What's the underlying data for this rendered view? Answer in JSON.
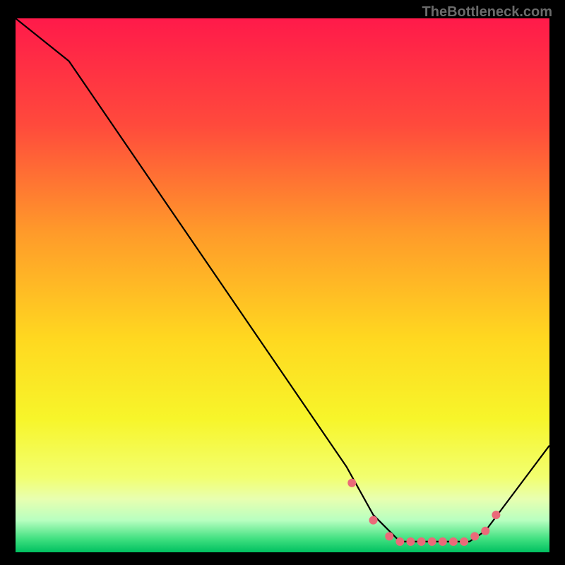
{
  "watermark": "TheBottleneck.com",
  "chart_data": {
    "type": "line",
    "title": "",
    "xlabel": "",
    "ylabel": "",
    "xlim": [
      0,
      100
    ],
    "ylim": [
      0,
      100
    ],
    "line": {
      "x": [
        0,
        10,
        62,
        67,
        72,
        85,
        88,
        100
      ],
      "y": [
        100,
        92,
        16,
        7,
        2,
        2,
        4,
        20
      ]
    },
    "markers": {
      "x": [
        63,
        67,
        70,
        72,
        74,
        76,
        78,
        80,
        82,
        84,
        86,
        88,
        90
      ],
      "y": [
        13,
        6,
        3,
        2,
        2,
        2,
        2,
        2,
        2,
        2,
        3,
        4,
        7
      ]
    },
    "gradient_stops": [
      {
        "offset": 0.0,
        "color": "#ff1a4a"
      },
      {
        "offset": 0.2,
        "color": "#ff4a3c"
      },
      {
        "offset": 0.4,
        "color": "#ff9a2a"
      },
      {
        "offset": 0.6,
        "color": "#ffd820"
      },
      {
        "offset": 0.75,
        "color": "#f7f52a"
      },
      {
        "offset": 0.86,
        "color": "#f2ff70"
      },
      {
        "offset": 0.9,
        "color": "#e8ffb0"
      },
      {
        "offset": 0.94,
        "color": "#b8ffc0"
      },
      {
        "offset": 0.975,
        "color": "#40e080"
      },
      {
        "offset": 1.0,
        "color": "#00c060"
      }
    ],
    "marker_color": "#ea6a79",
    "line_color": "#000000"
  }
}
